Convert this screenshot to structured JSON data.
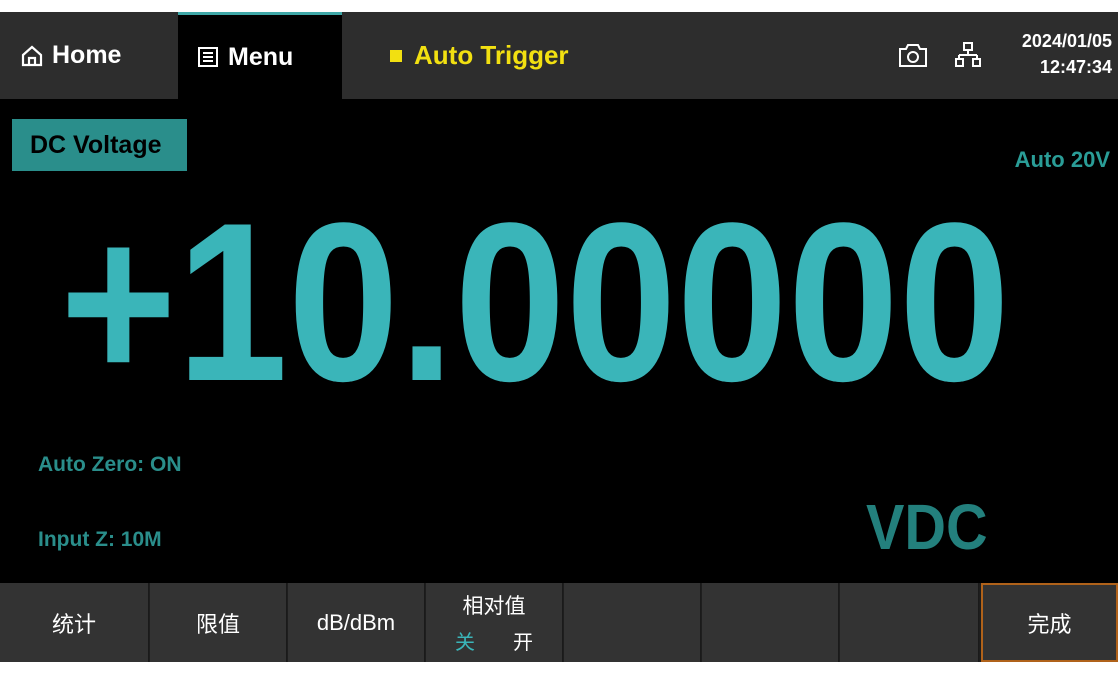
{
  "topbar": {
    "home_label": "Home",
    "menu_label": "Menu",
    "trigger_label": "Auto Trigger",
    "date": "2024/01/05",
    "time": "12:47:34",
    "icons": [
      "home-icon",
      "menu-icon",
      "camera-icon",
      "network-icon"
    ]
  },
  "measurement": {
    "function": "DC Voltage",
    "range": "Auto 20V",
    "reading": "+10.00000",
    "unit": "VDC",
    "auto_zero": "Auto Zero: ON",
    "input_z": "Input Z: 10M"
  },
  "softkeys": {
    "stats": "统计",
    "limit": "限值",
    "db": "dB/dBm",
    "relative": "相对值",
    "relative_off": "关",
    "relative_on": "开",
    "done": "完成"
  },
  "colors": {
    "accent": "#3ab5b9",
    "label_bg": "#2a8e8b",
    "trigger": "#f2e011",
    "done_border": "#b0621a"
  }
}
